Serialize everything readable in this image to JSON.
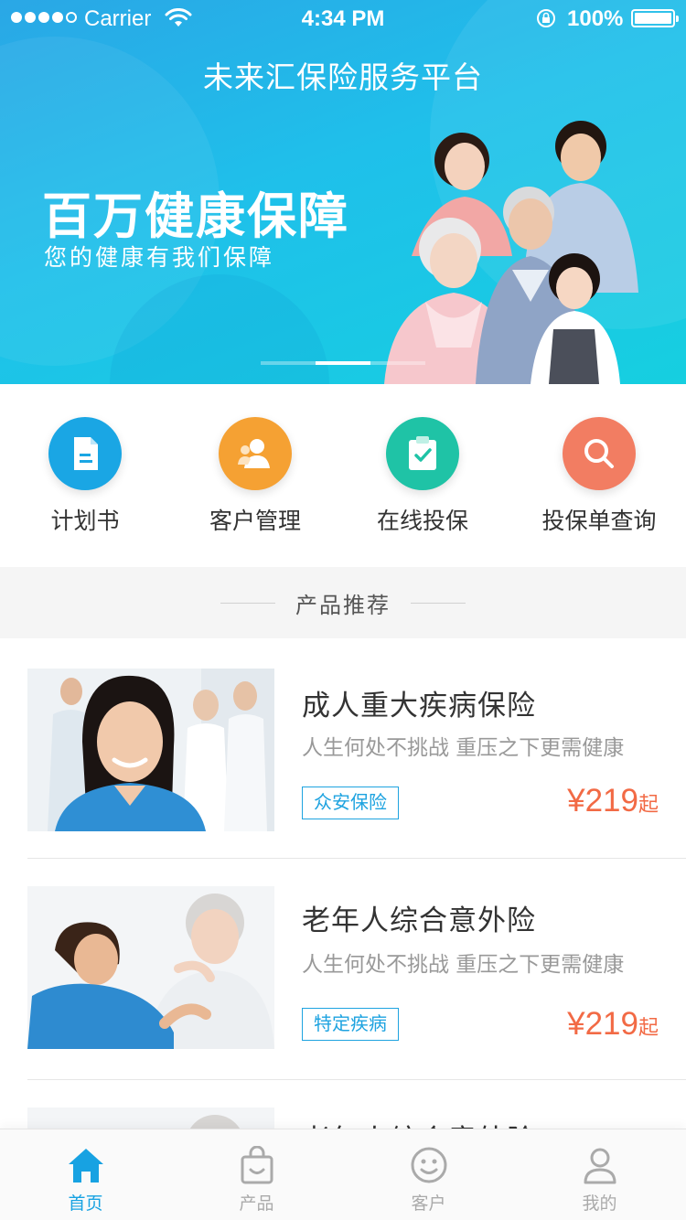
{
  "status_bar": {
    "carrier": "Carrier",
    "time": "4:34 PM",
    "battery": "100%"
  },
  "header": {
    "title": "未来汇保险服务平台"
  },
  "banner": {
    "headline": "百万健康保障",
    "subtitle": "您的健康有我们保障",
    "slide_count": 3,
    "active_slide": 1
  },
  "quick_actions": [
    {
      "label": "计划书",
      "icon": "document-icon",
      "color": "#1aa6e4"
    },
    {
      "label": "客户管理",
      "icon": "user-icon",
      "color": "#f5a133"
    },
    {
      "label": "在线投保",
      "icon": "clipboard-check-icon",
      "color": "#1fc3a6"
    },
    {
      "label": "投保单查询",
      "icon": "search-icon",
      "color": "#f27d62"
    }
  ],
  "section": {
    "title": "产品推荐"
  },
  "products": [
    {
      "name": "成人重大疾病保险",
      "description": "人生何处不挑战 重压之下更需健康",
      "tag": "众安保险",
      "price": "¥219",
      "price_suffix": "起"
    },
    {
      "name": "老年人综合意外险",
      "description": "人生何处不挑战 重压之下更需健康",
      "tag": "特定疾病",
      "price": "¥219",
      "price_suffix": "起"
    },
    {
      "name": "老年人综合意外险"
    }
  ],
  "tabbar": {
    "items": [
      {
        "label": "首页",
        "icon": "home-icon",
        "active": true
      },
      {
        "label": "产品",
        "icon": "shopping-bag-icon",
        "active": false
      },
      {
        "label": "客户",
        "icon": "smiley-icon",
        "active": false
      },
      {
        "label": "我的",
        "icon": "profile-icon",
        "active": false
      }
    ]
  },
  "colors": {
    "primary": "#17a2e2",
    "price": "#f26a45"
  }
}
